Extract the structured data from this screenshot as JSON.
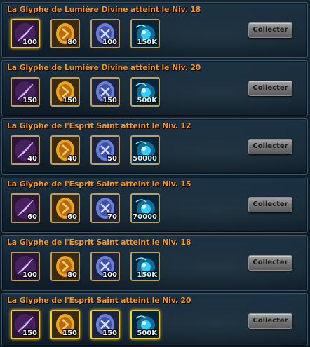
{
  "rows": [
    {
      "title": "La Glyphe de Lumière Divine atteint le Niv. 18",
      "button_label": "Collecter",
      "rewards": [
        {
          "icon": "feather-icon",
          "qty": "100",
          "rarity": "gold"
        },
        {
          "icon": "rune-stone-icon",
          "qty": "80",
          "rarity": "common"
        },
        {
          "icon": "blue-rune-icon",
          "qty": "100",
          "rarity": "common"
        },
        {
          "icon": "spirit-orb-icon",
          "qty": "150K",
          "rarity": "common"
        }
      ]
    },
    {
      "title": "La Glyphe de Lumière Divine atteint le Niv. 20",
      "button_label": "Collecter",
      "rewards": [
        {
          "icon": "feather-icon",
          "qty": "150",
          "rarity": "common"
        },
        {
          "icon": "rune-stone-icon",
          "qty": "150",
          "rarity": "common"
        },
        {
          "icon": "blue-rune-icon",
          "qty": "150",
          "rarity": "common"
        },
        {
          "icon": "spirit-orb-icon",
          "qty": "500K",
          "rarity": "common"
        }
      ]
    },
    {
      "title": "La Glyphe de l'Esprit Saint atteint le Niv. 12",
      "button_label": "Collecter",
      "rewards": [
        {
          "icon": "feather-icon",
          "qty": "40",
          "rarity": "common"
        },
        {
          "icon": "rune-stone-icon",
          "qty": "40",
          "rarity": "common"
        },
        {
          "icon": "blue-rune-icon",
          "qty": "50",
          "rarity": "common"
        },
        {
          "icon": "spirit-orb-icon",
          "qty": "50000",
          "rarity": "common"
        }
      ]
    },
    {
      "title": "La Glyphe de l'Esprit Saint atteint le Niv. 15",
      "button_label": "Collecter",
      "rewards": [
        {
          "icon": "feather-icon",
          "qty": "60",
          "rarity": "common"
        },
        {
          "icon": "rune-stone-icon",
          "qty": "60",
          "rarity": "common"
        },
        {
          "icon": "blue-rune-icon",
          "qty": "70",
          "rarity": "common"
        },
        {
          "icon": "spirit-orb-icon",
          "qty": "70000",
          "rarity": "common"
        }
      ]
    },
    {
      "title": "La Glyphe de l'Esprit Saint atteint le Niv. 18",
      "button_label": "Collecter",
      "rewards": [
        {
          "icon": "feather-icon",
          "qty": "100",
          "rarity": "common"
        },
        {
          "icon": "rune-stone-icon",
          "qty": "80",
          "rarity": "common"
        },
        {
          "icon": "blue-rune-icon",
          "qty": "100",
          "rarity": "common"
        },
        {
          "icon": "spirit-orb-icon",
          "qty": "150K",
          "rarity": "common"
        }
      ]
    },
    {
      "title": "La Glyphe de l'Esprit Saint atteint le Niv. 20",
      "button_label": "Collecter",
      "rewards": [
        {
          "icon": "feather-icon",
          "qty": "150",
          "rarity": "gold"
        },
        {
          "icon": "rune-stone-icon",
          "qty": "150",
          "rarity": "gold"
        },
        {
          "icon": "blue-rune-icon",
          "qty": "150",
          "rarity": "gold"
        },
        {
          "icon": "spirit-orb-icon",
          "qty": "500K",
          "rarity": "gold"
        }
      ]
    }
  ],
  "colors": {
    "title": "#f29a2e",
    "panel": "#1d3446",
    "button": "#8a8a8a"
  }
}
